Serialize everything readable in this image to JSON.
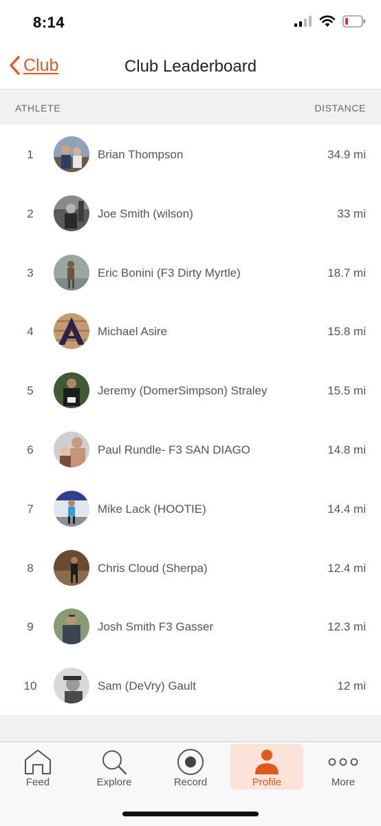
{
  "status_bar": {
    "time": "8:14"
  },
  "nav": {
    "back_label": "Club",
    "title": "Club Leaderboard"
  },
  "table": {
    "header_athlete": "ATHLETE",
    "header_distance": "DISTANCE",
    "rows": [
      {
        "rank": "1",
        "name": "Brian Thompson",
        "distance": "34.9 mi"
      },
      {
        "rank": "2",
        "name": "Joe Smith (wilson)",
        "distance": "33 mi"
      },
      {
        "rank": "3",
        "name": "Eric Bonini (F3 Dirty Myrtle)",
        "distance": "18.7 mi"
      },
      {
        "rank": "4",
        "name": "Michael Asire",
        "distance": "15.8 mi"
      },
      {
        "rank": "5",
        "name": "Jeremy (DomerSimpson) Straley",
        "distance": "15.5 mi"
      },
      {
        "rank": "6",
        "name": "Paul Rundle- F3 SAN DIAGO",
        "distance": "14.8 mi"
      },
      {
        "rank": "7",
        "name": "Mike Lack (HOOTIE)",
        "distance": "14.4 mi"
      },
      {
        "rank": "8",
        "name": "Chris Cloud (Sherpa)",
        "distance": "12.4 mi"
      },
      {
        "rank": "9",
        "name": "Josh Smith F3 Gasser",
        "distance": "12.3 mi"
      },
      {
        "rank": "10",
        "name": "Sam (DeVry) Gault",
        "distance": "12 mi"
      }
    ]
  },
  "tabs": [
    {
      "label": "Feed",
      "icon": "home-icon"
    },
    {
      "label": "Explore",
      "icon": "search-icon"
    },
    {
      "label": "Record",
      "icon": "record-icon"
    },
    {
      "label": "Profile",
      "icon": "person-icon",
      "active": true
    },
    {
      "label": "More",
      "icon": "more-dots-icon"
    }
  ],
  "colors": {
    "accent": "#e0581a",
    "active_tab_bg": "#fbe3d9"
  }
}
